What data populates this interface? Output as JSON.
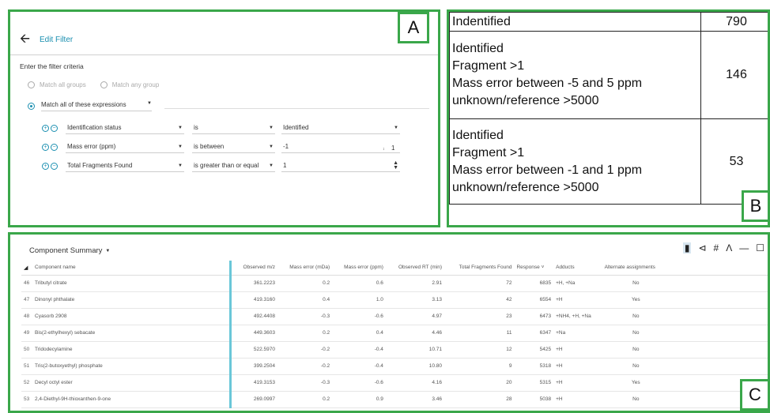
{
  "panel_letters": {
    "a": "A",
    "b": "B",
    "c": "C"
  },
  "edit_filter": {
    "title": "Edit Filter",
    "criteria_label": "Enter the filter criteria",
    "match_all_groups": "Match all groups",
    "match_any_group": "Match any group",
    "match_expressions": "Match all of these expressions",
    "rows": [
      {
        "field": "Identification status",
        "operator": "is",
        "value": "Identified"
      },
      {
        "field": "Mass error (ppm)",
        "operator": "is between",
        "value": "-1",
        "second_value": "1"
      },
      {
        "field": "Total Fragments Found",
        "operator": "is greater than or equal",
        "value": "1"
      }
    ]
  },
  "criteria_table": {
    "rows": [
      {
        "lines": [
          "Indentified"
        ],
        "count": "790"
      },
      {
        "lines": [
          "Identified",
          "Fragment >1",
          "Mass error between -5 and 5 ppm",
          "unknown/reference >5000"
        ],
        "count": "146"
      },
      {
        "lines": [
          "Identified",
          "Fragment >1",
          "Mass error between -1 and 1 ppm",
          "unknown/reference >5000"
        ],
        "count": "53"
      }
    ]
  },
  "component_summary": {
    "title": "Component Summary",
    "toolbar_icons": [
      "filter-icon",
      "share-icon",
      "hash-icon",
      "peak-icon",
      "minimize-icon",
      "maximize-icon"
    ],
    "columns": [
      "Component name",
      "Observed m/z",
      "Mass error (mDa)",
      "Mass error (ppm)",
      "Observed RT (min)",
      "Total Fragments Found",
      "Response",
      "Adducts",
      "Alternate assignments"
    ],
    "rows": [
      {
        "idx": "46",
        "name": "Tributyl citrate",
        "mz": "361.2223",
        "mda": "0.2",
        "ppm": "0.6",
        "rt": "2.91",
        "frag": "72",
        "resp": "6835",
        "adducts": "+H, +Na",
        "alt": "No"
      },
      {
        "idx": "47",
        "name": "Dinonyl phthalate",
        "mz": "419.3160",
        "mda": "0.4",
        "ppm": "1.0",
        "rt": "3.13",
        "frag": "42",
        "resp": "6554",
        "adducts": "+H",
        "alt": "Yes"
      },
      {
        "idx": "48",
        "name": "Cyasorb 2908",
        "mz": "492.4408",
        "mda": "-0.3",
        "ppm": "-0.6",
        "rt": "4.97",
        "frag": "23",
        "resp": "6473",
        "adducts": "+NH4, +H, +Na",
        "alt": "No"
      },
      {
        "idx": "49",
        "name": "Bis(2-ethylhexyl) sebacate",
        "mz": "449.3603",
        "mda": "0.2",
        "ppm": "0.4",
        "rt": "4.46",
        "frag": "11",
        "resp": "6347",
        "adducts": "+Na",
        "alt": "No"
      },
      {
        "idx": "50",
        "name": "Tridodecylamine",
        "mz": "522.5970",
        "mda": "-0.2",
        "ppm": "-0.4",
        "rt": "10.71",
        "frag": "12",
        "resp": "5425",
        "adducts": "+H",
        "alt": "No"
      },
      {
        "idx": "51",
        "name": "Tris(2-butoxyethyl) phosphate",
        "mz": "399.2504",
        "mda": "-0.2",
        "ppm": "-0.4",
        "rt": "10.80",
        "frag": "9",
        "resp": "5318",
        "adducts": "+H",
        "alt": "No"
      },
      {
        "idx": "52",
        "name": "Decyl octyl ester",
        "mz": "419.3153",
        "mda": "-0.3",
        "ppm": "-0.6",
        "rt": "4.16",
        "frag": "20",
        "resp": "5315",
        "adducts": "+H",
        "alt": "Yes"
      },
      {
        "idx": "53",
        "name": "2,4-Diethyl-9H-thioxanthen-9-one",
        "mz": "269.0997",
        "mda": "0.2",
        "ppm": "0.9",
        "rt": "3.46",
        "frag": "28",
        "resp": "5038",
        "adducts": "+H",
        "alt": "No"
      }
    ]
  },
  "colors": {
    "panel_border": "#3aa74a",
    "accent": "#1a8fb0",
    "column_separator": "#6ac7d8"
  }
}
